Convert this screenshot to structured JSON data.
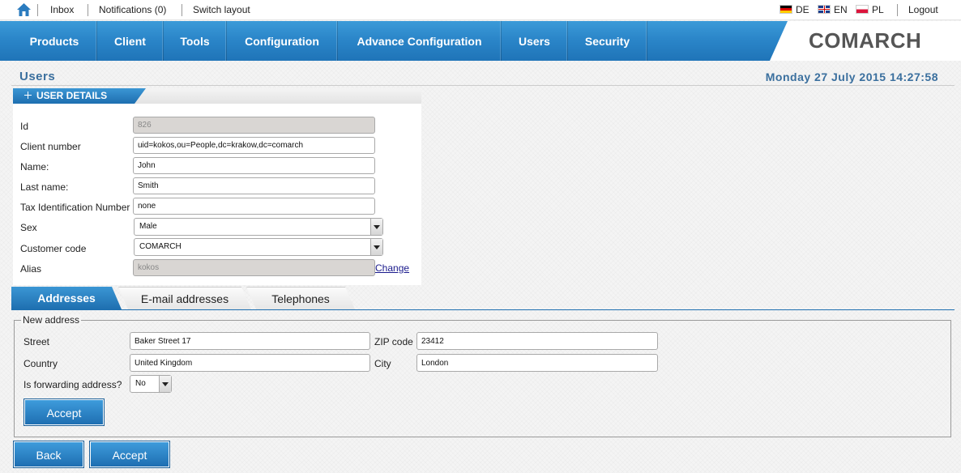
{
  "topbar": {
    "inbox": "Inbox",
    "notifications": "Notifications (0)",
    "switch_layout": "Switch layout",
    "lang_de": "DE",
    "lang_en": "EN",
    "lang_pl": "PL",
    "logout": "Logout",
    "home_icon": "home-icon"
  },
  "nav": {
    "items": [
      "Products",
      "Client",
      "Tools",
      "Configuration",
      "Advance Configuration",
      "Users",
      "Security"
    ],
    "logo": "COMARCH",
    "accent": "#2b86c9"
  },
  "page": {
    "title": "Users",
    "datetime": "Monday 27 July 2015 14:27:58"
  },
  "user_details": {
    "header": "USER DETAILS",
    "fields": {
      "id": {
        "label": "Id",
        "value": "826"
      },
      "client_number": {
        "label": "Client number",
        "value": "uid=kokos,ou=People,dc=krakow,dc=comarch"
      },
      "name": {
        "label": "Name:",
        "value": "John"
      },
      "last_name": {
        "label": "Last name:",
        "value": "Smith"
      },
      "tax_id": {
        "label": "Tax Identification Number",
        "value": "none"
      },
      "sex": {
        "label": "Sex",
        "value": "Male"
      },
      "customer_code": {
        "label": "Customer code",
        "value": "COMARCH"
      },
      "alias": {
        "label": "Alias",
        "value": "kokos"
      }
    },
    "change_link": "Change"
  },
  "tabs": {
    "addresses": "Addresses",
    "emails": "E-mail addresses",
    "telephones": "Telephones"
  },
  "new_address": {
    "legend": "New address",
    "street_label": "Street",
    "street_value": "Baker Street 17",
    "zip_label": "ZIP code",
    "zip_value": "23412",
    "country_label": "Country",
    "country_value": "United Kingdom",
    "city_label": "City",
    "city_value": "London",
    "forwarding_label": "Is forwarding address?",
    "forwarding_value": "No",
    "accept": "Accept"
  },
  "footer": {
    "back": "Back",
    "accept": "Accept"
  }
}
